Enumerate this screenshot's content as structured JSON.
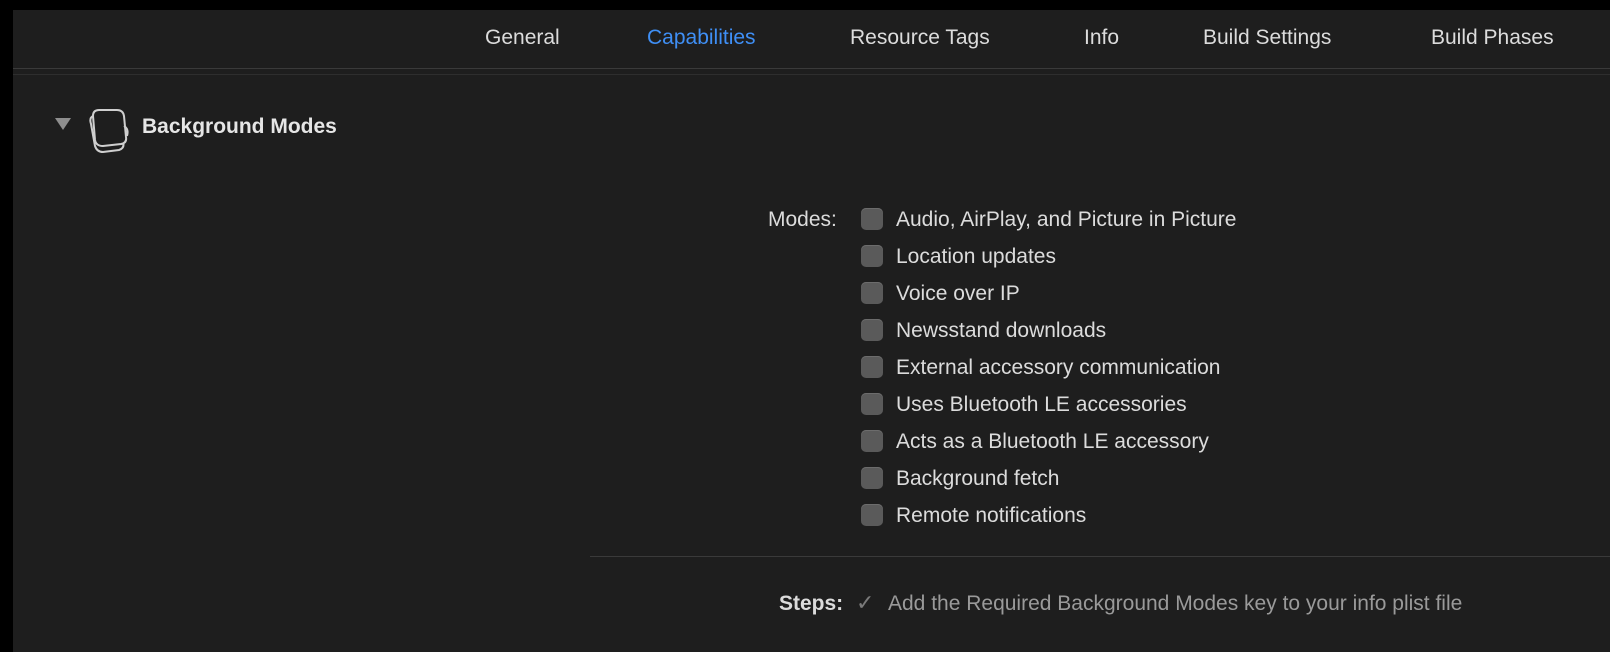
{
  "tabs": {
    "general": "General",
    "capabilities": "Capabilities",
    "resource_tags": "Resource Tags",
    "info": "Info",
    "build_settings": "Build Settings",
    "build_phases": "Build Phases"
  },
  "active_tab": "Capabilities",
  "section": {
    "title": "Background Modes",
    "icon": "stacked-windows-icon",
    "expanded": true
  },
  "modes": {
    "label": "Modes:",
    "items": [
      {
        "label": "Audio, AirPlay, and Picture in Picture",
        "checked": false
      },
      {
        "label": "Location updates",
        "checked": false
      },
      {
        "label": "Voice over IP",
        "checked": false
      },
      {
        "label": "Newsstand downloads",
        "checked": false
      },
      {
        "label": "External accessory communication",
        "checked": false
      },
      {
        "label": "Uses Bluetooth LE accessories",
        "checked": false
      },
      {
        "label": "Acts as a Bluetooth LE accessory",
        "checked": false
      },
      {
        "label": "Background fetch",
        "checked": false
      },
      {
        "label": "Remote notifications",
        "checked": false
      }
    ]
  },
  "steps": {
    "label": "Steps:",
    "check_glyph": "✓",
    "items": [
      {
        "text": "Add the Required Background Modes key to your info plist file",
        "done": true
      }
    ]
  },
  "colors": {
    "background": "#1e1e1e",
    "accent": "#3f8ff5",
    "text": "#dcdcdc",
    "muted": "#9a9a9a"
  }
}
